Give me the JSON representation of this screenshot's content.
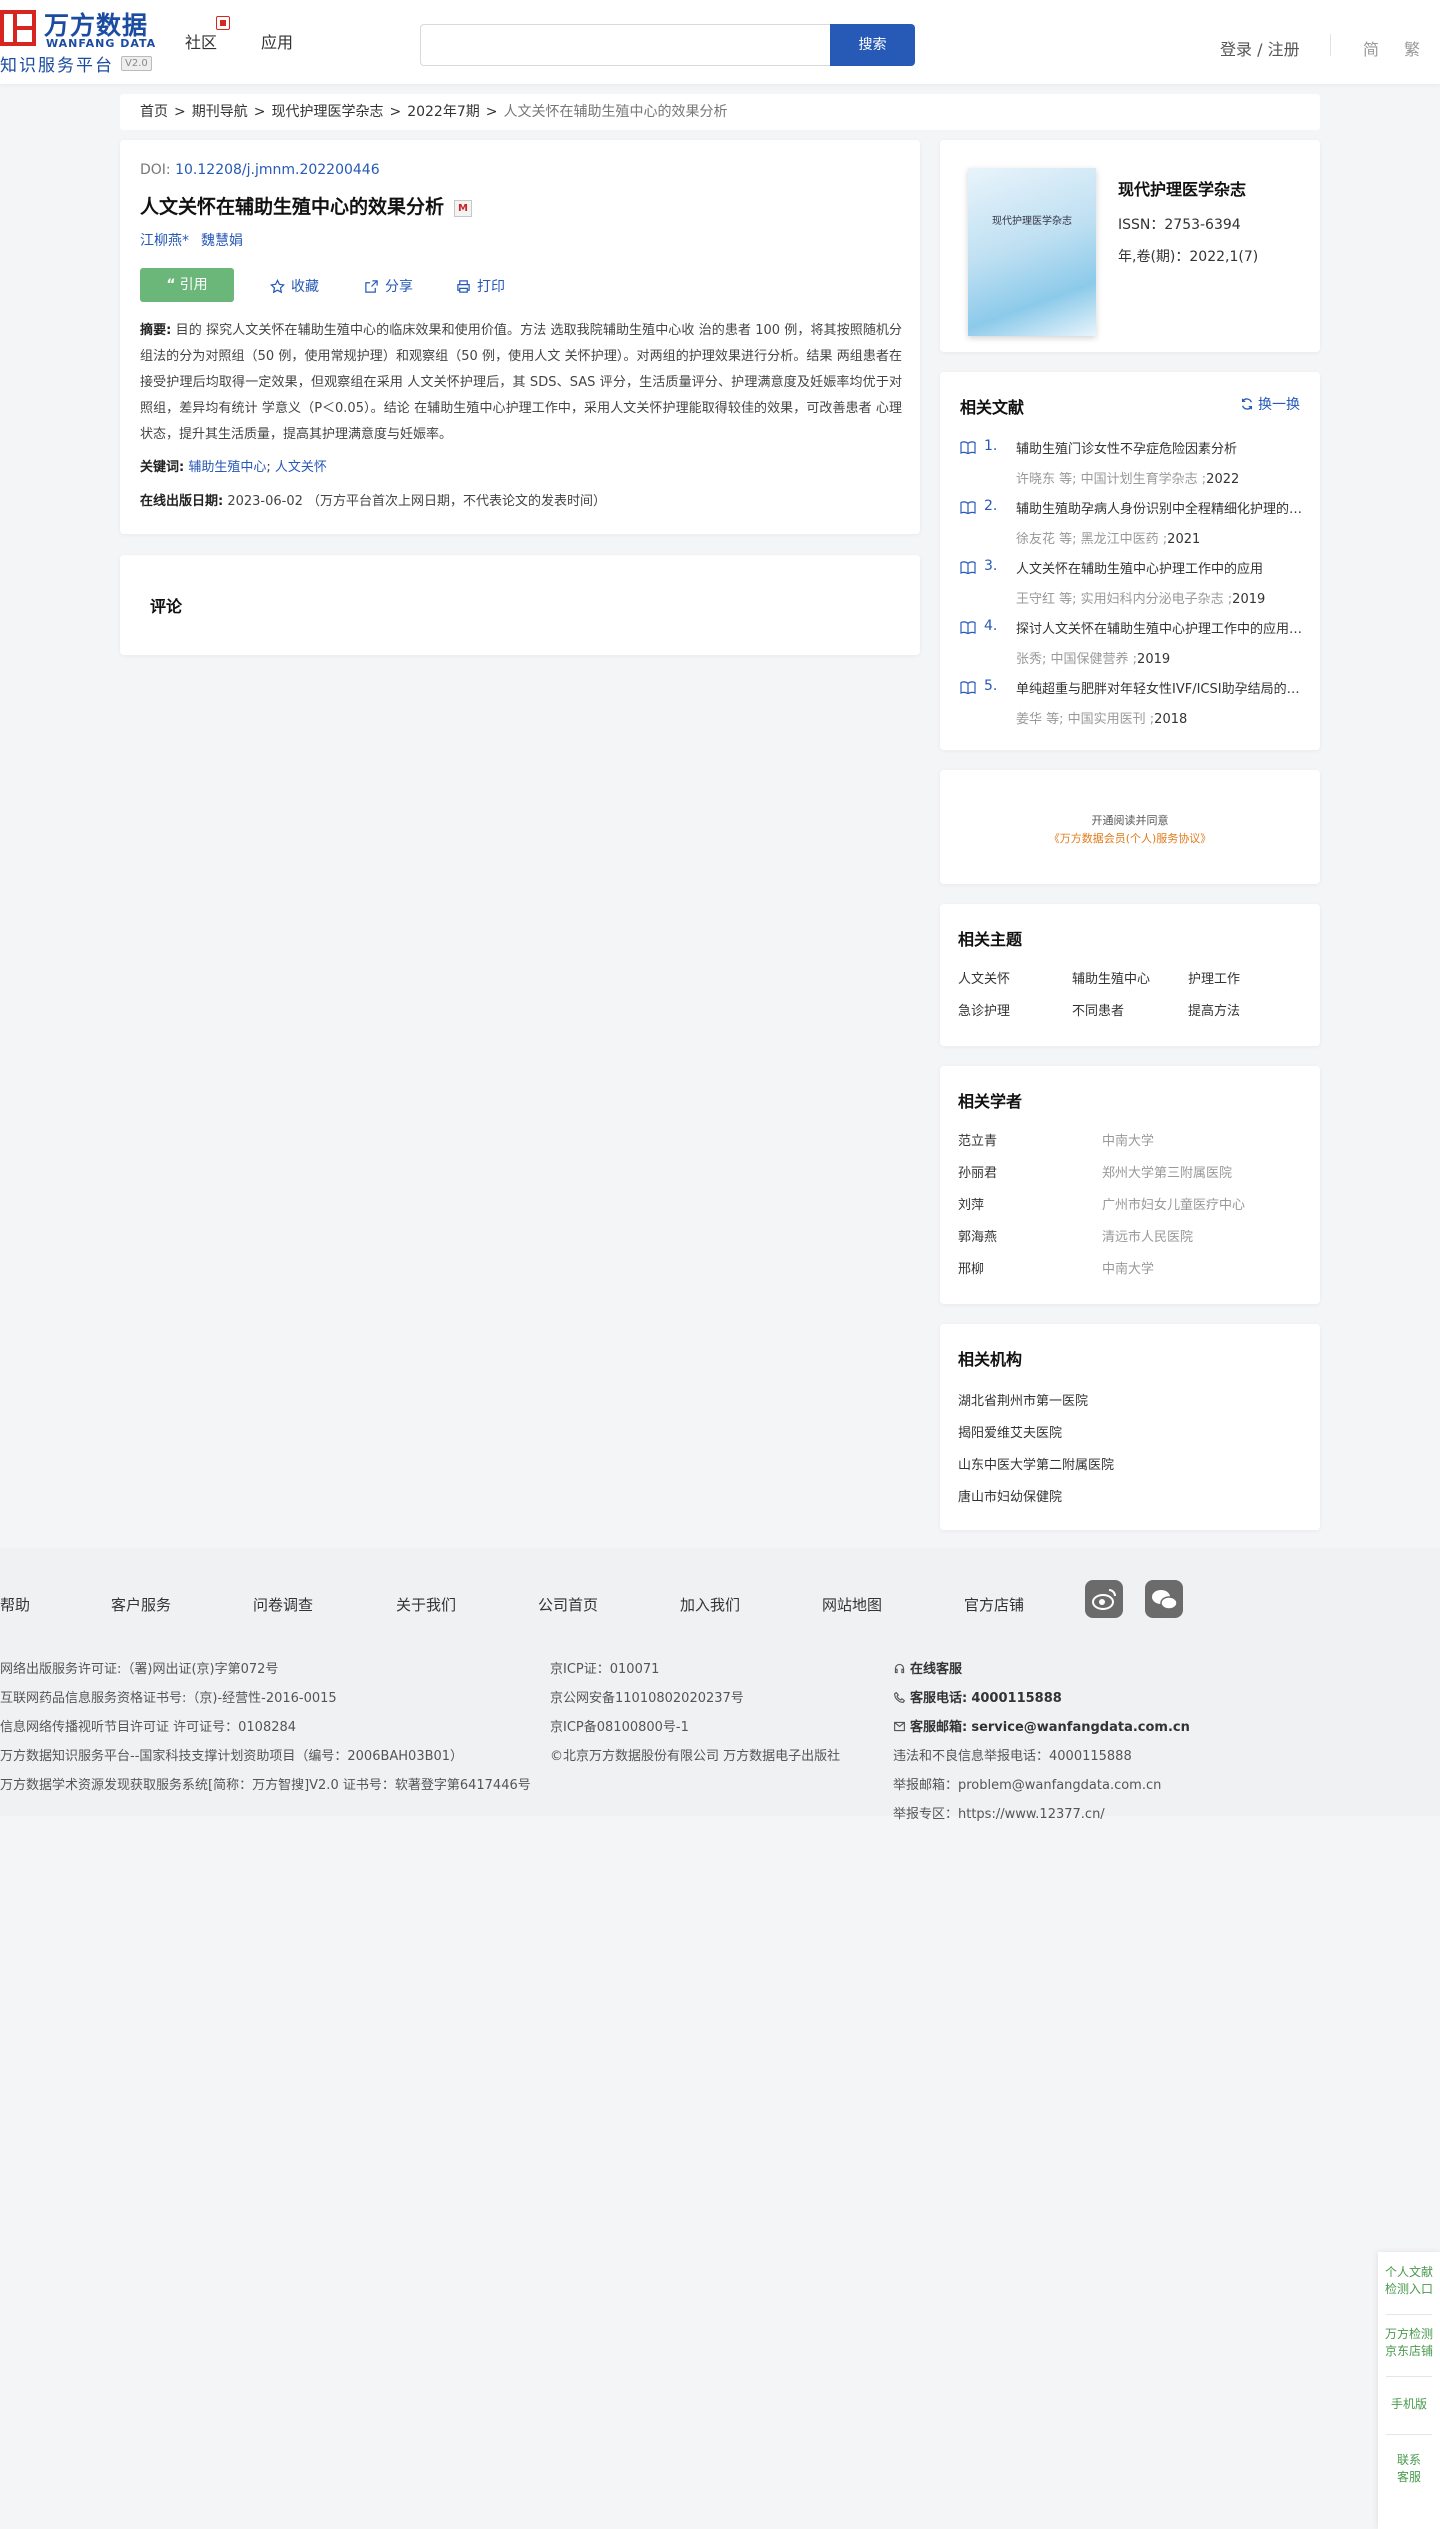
{
  "header": {
    "logo_cn": "万方数据",
    "logo_en": "WANFANG DATA",
    "logo_sub": "知识服务平台",
    "logo_ver": "V2.0",
    "nav": [
      "社区",
      "应用"
    ],
    "search_placeholder": "",
    "search_button": "搜索",
    "login": "登录 / 注册",
    "lang_simplified": "简",
    "lang_traditional": "繁"
  },
  "breadcrumb": [
    "首页",
    "期刊导航",
    "现代护理医学杂志",
    "2022年7期",
    "人文关怀在辅助生殖中心的效果分析"
  ],
  "breadcrumb_sep": ">",
  "article": {
    "doi_label": "DOI:",
    "doi": "10.12208/j.jmnm.202200446",
    "title": "人文关怀在辅助生殖中心的效果分析",
    "badge": "M",
    "authors": [
      "江柳燕*",
      "魏慧娟"
    ],
    "cite": "引用",
    "collect": "收藏",
    "share": "分享",
    "print": "打印",
    "abstract_label": "摘要:",
    "abstract": "目的 探究人文关怀在辅助生殖中心的临床效果和使用价值。方法 选取我院辅助生殖中心收 治的患者 100 例，将其按照随机分组法的分为对照组（50 例，使用常规护理）和观察组（50 例，使用人文 关怀护理）。对两组的护理效果进行分析。结果 两组患者在接受护理后均取得一定效果，但观察组在采用 人文关怀护理后，其 SDS、SAS 评分，生活质量评分、护理满意度及妊娠率均优于对照组，差异均有统计 学意义（P＜0.05）。结论 在辅助生殖中心护理工作中，采用人文关怀护理能取得较佳的效果，可改善患者 心理状态，提升其生活质量，提高其护理满意度与妊娠率。",
    "keywords_label": "关键词:",
    "keywords": [
      "辅助生殖中心",
      "人文关怀"
    ],
    "keywords_sep": ";",
    "pubdate_label": "在线出版日期:",
    "pubdate": "2023-06-02",
    "pubdate_note": "（万方平台首次上网日期，不代表论文的发表时间）"
  },
  "comments": {
    "title": "评论"
  },
  "journal": {
    "cover_text": "现代护理医学杂志",
    "name": "现代护理医学杂志",
    "issn": "ISSN：2753-6394",
    "volume": "年,卷(期)：2022,1(7)"
  },
  "related_docs": {
    "title": "相关文献",
    "refresh": "换一换",
    "items": [
      {
        "num": "1.",
        "title": "辅助生殖门诊女性不孕症危险因素分析",
        "authors": "许晓东   等;",
        "source": "中国计划生育学杂志 ;",
        "year": "2022"
      },
      {
        "num": "2.",
        "title": "辅助生殖助孕病人身份识别中全程精细化护理的应用",
        "authors": "徐友花   等;",
        "source": "黑龙江中医药 ;",
        "year": "2021"
      },
      {
        "num": "3.",
        "title": "人文关怀在辅助生殖中心护理工作中的应用",
        "authors": "王守红   等;",
        "source": "实用妇科内分泌电子杂志 ;",
        "year": "2019"
      },
      {
        "num": "4.",
        "title": "探讨人文关怀在辅助生殖中心护理工作中的应用效果",
        "authors": "张秀;",
        "source": "中国保健营养 ;",
        "year": "2019"
      },
      {
        "num": "5.",
        "title": "单纯超重与肥胖对年轻女性IVF/ICSI助孕结局的影响",
        "authors": "姜华   等;",
        "source": "中国实用医刊 ;",
        "year": "2018"
      }
    ]
  },
  "open_notice": {
    "line1": "开通阅读并同意",
    "line2": "《万方数据会员(个人)服务协议》"
  },
  "related_topics": {
    "title": "相关主题",
    "items": [
      "人文关怀",
      "辅助生殖中心",
      "护理工作",
      "急诊护理",
      "不同患者",
      "提高方法"
    ]
  },
  "related_scholars": {
    "title": "相关学者",
    "items": [
      {
        "name": "范立青",
        "org": "中南大学"
      },
      {
        "name": "孙丽君",
        "org": "郑州大学第三附属医院"
      },
      {
        "name": "刘萍",
        "org": "广州市妇女儿童医疗中心"
      },
      {
        "name": "郭海燕",
        "org": "清远市人民医院"
      },
      {
        "name": "邢柳",
        "org": "中南大学"
      }
    ]
  },
  "related_orgs": {
    "title": "相关机构",
    "items": [
      "湖北省荆州市第一医院",
      "揭阳爱维艾夫医院",
      "山东中医大学第二附属医院",
      "唐山市妇幼保健院"
    ]
  },
  "footer": {
    "links": [
      "帮助",
      "客户服务",
      "问卷调查",
      "关于我们",
      "公司首页",
      "加入我们",
      "网站地图",
      "官方店铺"
    ],
    "col1": [
      "网络出版服务许可证:（署)网出证(京)字第072号",
      "互联网药品信息服务资格证书号:（京)-经营性-2016-0015",
      "信息网络传播视听节目许可证 许可证号：0108284",
      "万方数据知识服务平台--国家科技支撑计划资助项目（编号：2006BAH03B01）",
      "万方数据学术资源发现获取服务系统[简称：万方智搜]V2.0 证书号：软著登字第6417446号"
    ],
    "col2": [
      "京ICP证：010071",
      "京公网安备11010802020237号",
      "京ICP备08100800号-1",
      "©北京万方数据股份有限公司 万方数据电子出版社"
    ],
    "online_service": "在线客服",
    "phone_label": "客服电话:",
    "phone": "4000115888",
    "email_label": "客服邮箱:",
    "email": "service@wanfangdata.com.cn",
    "report_phone": "违法和不良信息举报电话：4000115888",
    "report_email": "举报邮箱：problem@wanfangdata.com.cn",
    "report_site": "举报专区：https://www.12377.cn/"
  },
  "float_bar": [
    "个人文献检测入口",
    "万方检测京东店铺",
    "手机版",
    "联系客服"
  ]
}
